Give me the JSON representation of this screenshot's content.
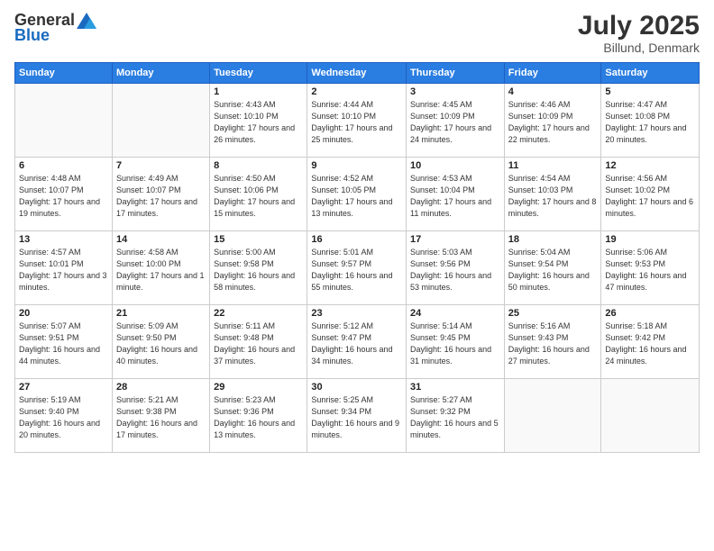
{
  "header": {
    "logo_general": "General",
    "logo_blue": "Blue",
    "month_year": "July 2025",
    "location": "Billund, Denmark"
  },
  "days_of_week": [
    "Sunday",
    "Monday",
    "Tuesday",
    "Wednesday",
    "Thursday",
    "Friday",
    "Saturday"
  ],
  "weeks": [
    [
      {
        "day": "",
        "info": ""
      },
      {
        "day": "",
        "info": ""
      },
      {
        "day": "1",
        "info": "Sunrise: 4:43 AM\nSunset: 10:10 PM\nDaylight: 17 hours and 26 minutes."
      },
      {
        "day": "2",
        "info": "Sunrise: 4:44 AM\nSunset: 10:10 PM\nDaylight: 17 hours and 25 minutes."
      },
      {
        "day": "3",
        "info": "Sunrise: 4:45 AM\nSunset: 10:09 PM\nDaylight: 17 hours and 24 minutes."
      },
      {
        "day": "4",
        "info": "Sunrise: 4:46 AM\nSunset: 10:09 PM\nDaylight: 17 hours and 22 minutes."
      },
      {
        "day": "5",
        "info": "Sunrise: 4:47 AM\nSunset: 10:08 PM\nDaylight: 17 hours and 20 minutes."
      }
    ],
    [
      {
        "day": "6",
        "info": "Sunrise: 4:48 AM\nSunset: 10:07 PM\nDaylight: 17 hours and 19 minutes."
      },
      {
        "day": "7",
        "info": "Sunrise: 4:49 AM\nSunset: 10:07 PM\nDaylight: 17 hours and 17 minutes."
      },
      {
        "day": "8",
        "info": "Sunrise: 4:50 AM\nSunset: 10:06 PM\nDaylight: 17 hours and 15 minutes."
      },
      {
        "day": "9",
        "info": "Sunrise: 4:52 AM\nSunset: 10:05 PM\nDaylight: 17 hours and 13 minutes."
      },
      {
        "day": "10",
        "info": "Sunrise: 4:53 AM\nSunset: 10:04 PM\nDaylight: 17 hours and 11 minutes."
      },
      {
        "day": "11",
        "info": "Sunrise: 4:54 AM\nSunset: 10:03 PM\nDaylight: 17 hours and 8 minutes."
      },
      {
        "day": "12",
        "info": "Sunrise: 4:56 AM\nSunset: 10:02 PM\nDaylight: 17 hours and 6 minutes."
      }
    ],
    [
      {
        "day": "13",
        "info": "Sunrise: 4:57 AM\nSunset: 10:01 PM\nDaylight: 17 hours and 3 minutes."
      },
      {
        "day": "14",
        "info": "Sunrise: 4:58 AM\nSunset: 10:00 PM\nDaylight: 17 hours and 1 minute."
      },
      {
        "day": "15",
        "info": "Sunrise: 5:00 AM\nSunset: 9:58 PM\nDaylight: 16 hours and 58 minutes."
      },
      {
        "day": "16",
        "info": "Sunrise: 5:01 AM\nSunset: 9:57 PM\nDaylight: 16 hours and 55 minutes."
      },
      {
        "day": "17",
        "info": "Sunrise: 5:03 AM\nSunset: 9:56 PM\nDaylight: 16 hours and 53 minutes."
      },
      {
        "day": "18",
        "info": "Sunrise: 5:04 AM\nSunset: 9:54 PM\nDaylight: 16 hours and 50 minutes."
      },
      {
        "day": "19",
        "info": "Sunrise: 5:06 AM\nSunset: 9:53 PM\nDaylight: 16 hours and 47 minutes."
      }
    ],
    [
      {
        "day": "20",
        "info": "Sunrise: 5:07 AM\nSunset: 9:51 PM\nDaylight: 16 hours and 44 minutes."
      },
      {
        "day": "21",
        "info": "Sunrise: 5:09 AM\nSunset: 9:50 PM\nDaylight: 16 hours and 40 minutes."
      },
      {
        "day": "22",
        "info": "Sunrise: 5:11 AM\nSunset: 9:48 PM\nDaylight: 16 hours and 37 minutes."
      },
      {
        "day": "23",
        "info": "Sunrise: 5:12 AM\nSunset: 9:47 PM\nDaylight: 16 hours and 34 minutes."
      },
      {
        "day": "24",
        "info": "Sunrise: 5:14 AM\nSunset: 9:45 PM\nDaylight: 16 hours and 31 minutes."
      },
      {
        "day": "25",
        "info": "Sunrise: 5:16 AM\nSunset: 9:43 PM\nDaylight: 16 hours and 27 minutes."
      },
      {
        "day": "26",
        "info": "Sunrise: 5:18 AM\nSunset: 9:42 PM\nDaylight: 16 hours and 24 minutes."
      }
    ],
    [
      {
        "day": "27",
        "info": "Sunrise: 5:19 AM\nSunset: 9:40 PM\nDaylight: 16 hours and 20 minutes."
      },
      {
        "day": "28",
        "info": "Sunrise: 5:21 AM\nSunset: 9:38 PM\nDaylight: 16 hours and 17 minutes."
      },
      {
        "day": "29",
        "info": "Sunrise: 5:23 AM\nSunset: 9:36 PM\nDaylight: 16 hours and 13 minutes."
      },
      {
        "day": "30",
        "info": "Sunrise: 5:25 AM\nSunset: 9:34 PM\nDaylight: 16 hours and 9 minutes."
      },
      {
        "day": "31",
        "info": "Sunrise: 5:27 AM\nSunset: 9:32 PM\nDaylight: 16 hours and 5 minutes."
      },
      {
        "day": "",
        "info": ""
      },
      {
        "day": "",
        "info": ""
      }
    ]
  ]
}
